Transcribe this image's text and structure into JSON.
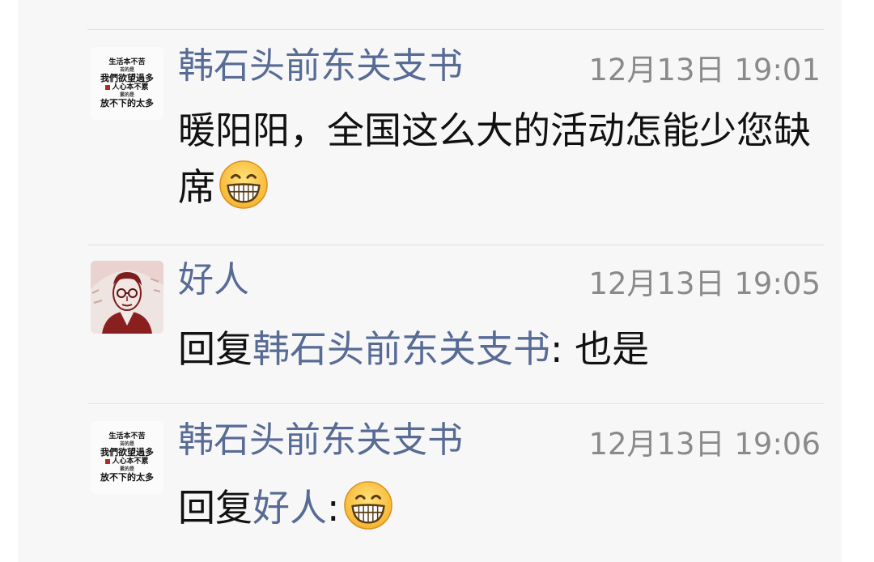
{
  "comments": [
    {
      "author": "韩石头前东关支书",
      "time": "12月13日 19:01",
      "text": "暖阳阳，全国这么大的活动怎能少您缺席",
      "emoji": "grinning-face"
    },
    {
      "author": "好人",
      "time": "12月13日 19:05",
      "reply_prefix": "回复",
      "reply_to": "韩石头前东关支书",
      "text": ": 也是"
    },
    {
      "author": "韩石头前东关支书",
      "time": "12月13日 19:06",
      "reply_prefix": "回复",
      "reply_to": "好人",
      "text": ":",
      "emoji": "grinning-face"
    }
  ],
  "avatar_calligraphy": {
    "line1": "生活本不苦",
    "line2": "苦的是",
    "line3": "我們欲望過多",
    "line4": "人心本不累",
    "line5": "累的是",
    "line6": "放不下的太多"
  },
  "colors": {
    "author_link": "#576b95",
    "timestamp": "#8a8a8a",
    "panel_background": "#f7f7f7"
  }
}
